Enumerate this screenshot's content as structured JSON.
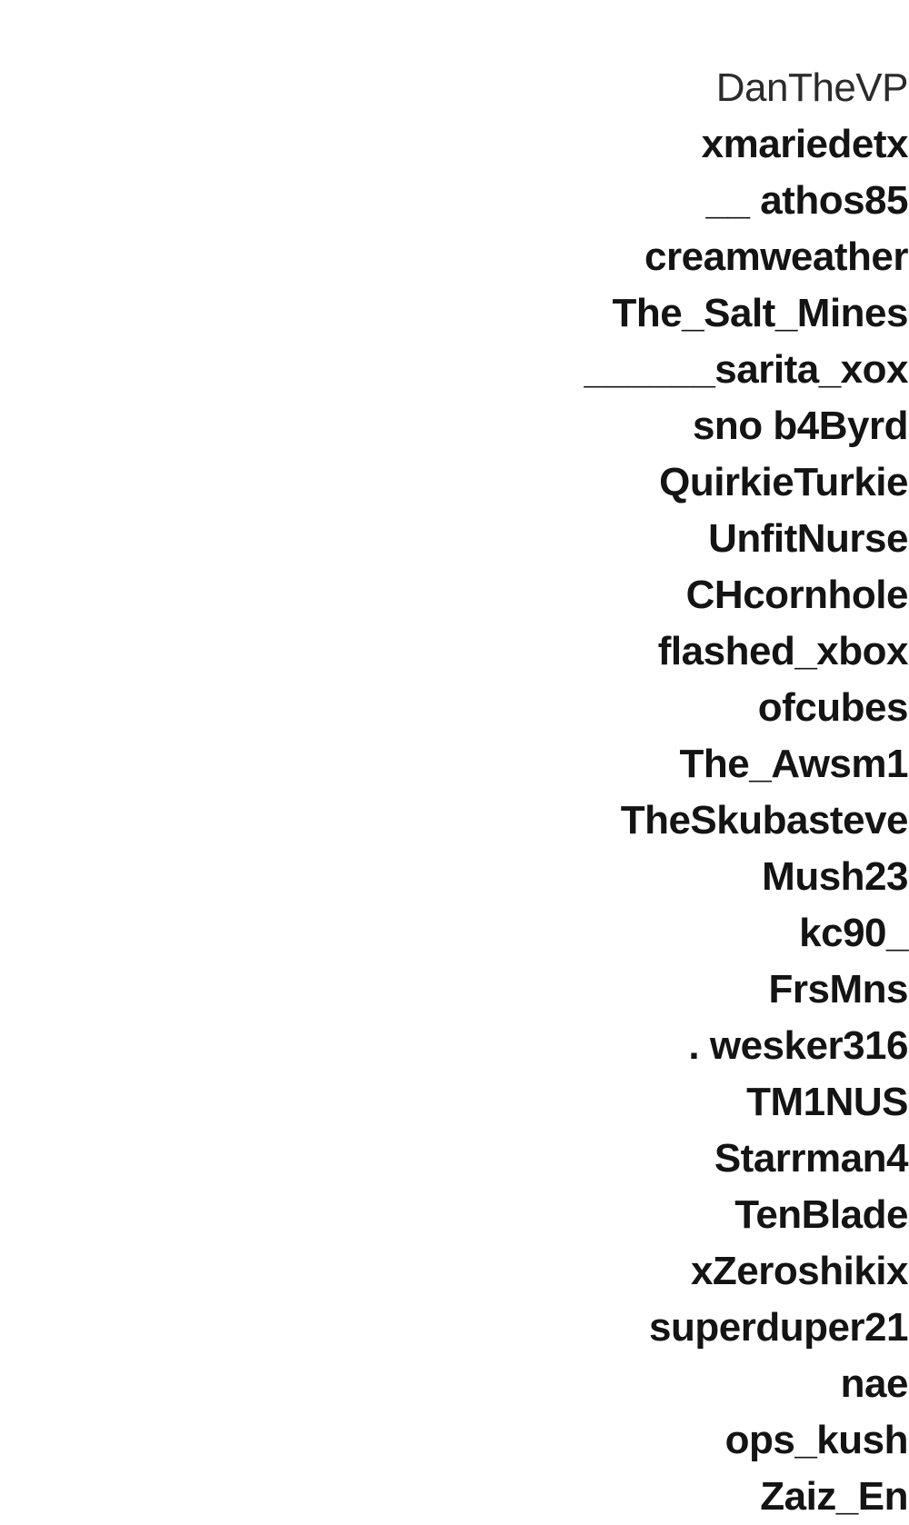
{
  "names": [
    "DanTheVP",
    "xmariedetx",
    "__ athos85",
    "creamweather",
    "The_Salt_Mines",
    "______sarita_xox",
    "sno b4Byrd",
    "QuirkieTurkie",
    "UnfitNurse",
    "CHcornhole",
    "flashed_xbox",
    "ofcubes",
    "The_Awsm1",
    "TheSkubasteve",
    "Mush23",
    "kc90_",
    "FrsMns",
    ". wesker316",
    "TM1NUS",
    "Starrman4",
    "TenBlade",
    "xZeroshikix",
    "superduper21",
    "nae",
    "ops_kush",
    "Zaiz_En"
  ]
}
